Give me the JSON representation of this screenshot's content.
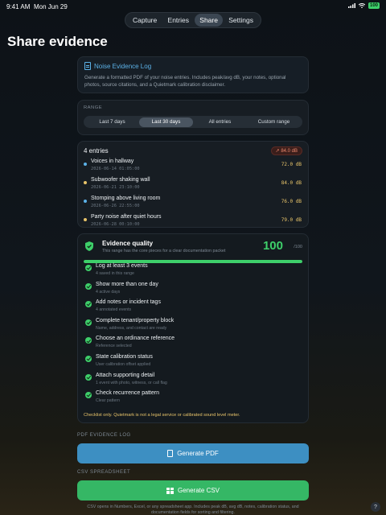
{
  "status": {
    "time": "9:41 AM",
    "date": "Mon Jun 29",
    "battery": "100"
  },
  "tabs": [
    {
      "label": "Capture"
    },
    {
      "label": "Entries"
    },
    {
      "label": "Share",
      "active": true
    },
    {
      "label": "Settings"
    }
  ],
  "page_title": "Share evidence",
  "info": {
    "title": "Noise Evidence Log",
    "description": "Generate a formatted PDF of your noise entries. Includes peak/avg dB, your notes, optional photos, source citations, and a Quietmark calibration disclaimer."
  },
  "range": {
    "label": "RANGE",
    "options": [
      "Last 7 days",
      "Last 30 days",
      "All entries",
      "Custom range"
    ],
    "selected": "Last 30 days"
  },
  "entries": {
    "count_label": "4 entries",
    "max_badge": "84.0 dB",
    "items": [
      {
        "name": "Voices in hallway",
        "timestamp": "2026-06-14 01:05:00",
        "db": "72.0 dB",
        "dot_color": "#5cb2e8"
      },
      {
        "name": "Subwoofer shaking wall",
        "timestamp": "2026-06-21 23:10:00",
        "db": "84.0 dB",
        "dot_color": "#e8c46a"
      },
      {
        "name": "Stomping above living room",
        "timestamp": "2026-06-26 22:55:00",
        "db": "76.0 dB",
        "dot_color": "#5cb2e8"
      },
      {
        "name": "Party noise after quiet hours",
        "timestamp": "2026-06-28 00:10:00",
        "db": "79.0 dB",
        "dot_color": "#e8c46a"
      }
    ]
  },
  "quality": {
    "title": "Evidence quality",
    "subtitle": "This range has the core pieces for a clear documentation packet",
    "score": "100",
    "max": "/100",
    "progress": 1.0,
    "checks": [
      {
        "title": "Log at least 3 events",
        "sub": "4 saved in this range"
      },
      {
        "title": "Show more than one day",
        "sub": "4 active days"
      },
      {
        "title": "Add notes or incident tags",
        "sub": "4 annotated events"
      },
      {
        "title": "Complete tenant/property block",
        "sub": "Name, address, and contact are ready"
      },
      {
        "title": "Choose an ordinance reference",
        "sub": "Reference selected"
      },
      {
        "title": "State calibration status",
        "sub": "User calibration offset applied"
      },
      {
        "title": "Attach supporting detail",
        "sub": "1 event with photo, witness, or call flag"
      },
      {
        "title": "Check recurrence pattern",
        "sub": "Clear pattern"
      }
    ],
    "disclaimer": "Checklist only. Quietmark is not a legal service or calibrated sound level meter."
  },
  "pdf": {
    "section_label": "PDF EVIDENCE LOG",
    "button_label": "Generate PDF"
  },
  "csv": {
    "section_label": "CSV SPREADSHEET",
    "button_label": "Generate CSV",
    "footnote": "CSV opens in Numbers, Excel, or any spreadsheet app. Includes peak dB, avg dB, notes, calibration status, and documentation fields for sorting and filtering."
  },
  "colors": {
    "accent_blue": "#3d8fc2",
    "accent_green": "#35b765",
    "warning": "#e8c46a"
  }
}
